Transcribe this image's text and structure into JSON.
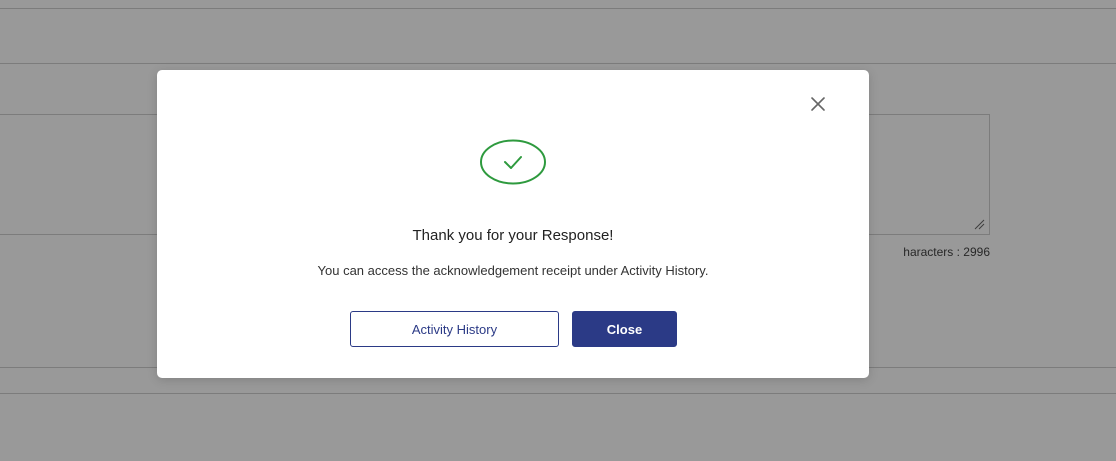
{
  "background": {
    "char_count_label": "haracters : 2996"
  },
  "modal": {
    "title": "Thank you for your Response!",
    "message": "You can access the acknowledgement receipt under Activity History.",
    "buttons": {
      "activity_history": "Activity History",
      "close": "Close"
    },
    "icons": {
      "close": "close-icon",
      "success": "check-circle-icon"
    }
  },
  "colors": {
    "primary": "#2b3a86",
    "success": "#2e9a3e",
    "overlay": "rgba(0,0,0,0.40)"
  }
}
